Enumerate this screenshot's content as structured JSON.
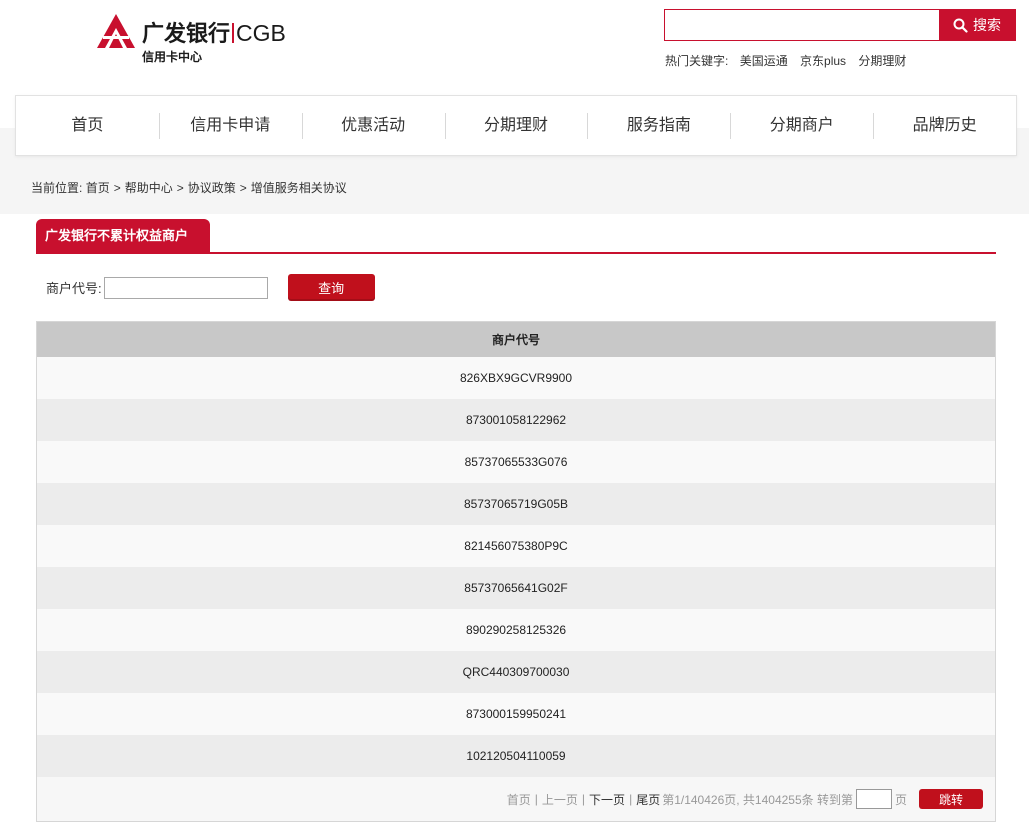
{
  "brand": {
    "name_cn": "广发银行",
    "name_en": "CGB",
    "subtitle": "信用卡中心",
    "accent_color": "#c8102e"
  },
  "search": {
    "value": "",
    "button_label": "搜索",
    "hot_label": "热门关键字:",
    "hot_keywords": [
      "美国运通",
      "京东plus",
      "分期理财"
    ]
  },
  "nav": {
    "items": [
      "首页",
      "信用卡申请",
      "优惠活动",
      "分期理财",
      "服务指南",
      "分期商户",
      "品牌历史"
    ]
  },
  "breadcrumb": {
    "label": "当前位置:",
    "items": [
      "首页",
      "帮助中心",
      "协议政策",
      "增值服务相关协议"
    ],
    "separator": ">"
  },
  "section": {
    "tab_title": "广发银行不累计权益商户"
  },
  "query": {
    "label": "商户代号:",
    "value": "",
    "button_label": "查询"
  },
  "table": {
    "header": "商户代号",
    "rows": [
      "826XBX9GCVR9900",
      "873001058122962",
      "85737065533G076",
      "85737065719G05B",
      "821456075380P9C",
      "85737065641G02F",
      "890290258125326",
      "QRC440309700030",
      "873000159950241",
      "102120504110059"
    ]
  },
  "pager": {
    "first": "首页",
    "prev": "上一页",
    "next": "下一页",
    "last": "尾页",
    "separator": "|",
    "info": "第1/140426页, 共1404255条 转到第",
    "page_suffix": "页",
    "jump_value": "",
    "jump_label": "跳转"
  }
}
